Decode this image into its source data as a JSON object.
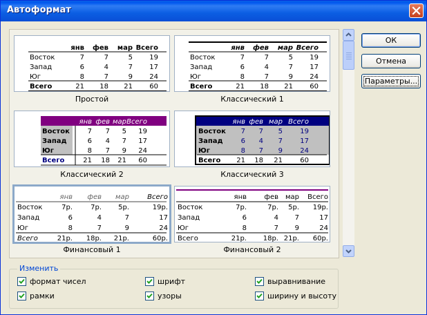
{
  "window": {
    "title": "Автоформат",
    "close_icon": "close-icon"
  },
  "buttons": {
    "ok": "ОК",
    "cancel": "Отмена",
    "params": "Параметры..."
  },
  "gallery": {
    "items": [
      {
        "name": "Простой",
        "header": [
          "",
          "янв",
          "фев",
          "мар",
          "Всего"
        ],
        "rows": [
          [
            "Восток",
            "7",
            "7",
            "5",
            "19"
          ],
          [
            "Запад",
            "6",
            "4",
            "7",
            "17"
          ],
          [
            "Юг",
            "8",
            "7",
            "9",
            "24"
          ]
        ],
        "total": [
          "Всего",
          "21",
          "18",
          "21",
          "60"
        ]
      },
      {
        "name": "Классический 1",
        "header": [
          "",
          "янв",
          "фев",
          "мар",
          "Всего"
        ],
        "rows": [
          [
            "Восток",
            "7",
            "7",
            "5",
            "19"
          ],
          [
            "Запад",
            "6",
            "4",
            "7",
            "17"
          ],
          [
            "Юг",
            "8",
            "7",
            "9",
            "24"
          ]
        ],
        "total": [
          "Всего",
          "21",
          "18",
          "21",
          "60"
        ]
      },
      {
        "name": "Классический 2",
        "header": [
          "",
          "янв",
          "фев",
          "мар",
          "Всего"
        ],
        "rows": [
          [
            "Восток",
            "7",
            "7",
            "5",
            "19"
          ],
          [
            "Запад",
            "6",
            "4",
            "7",
            "17"
          ],
          [
            "Юг",
            "8",
            "7",
            "9",
            "24"
          ]
        ],
        "total": [
          "Всего",
          "21",
          "18",
          "21",
          "60"
        ]
      },
      {
        "name": "Классический 3",
        "header": [
          "",
          "янв",
          "фев",
          "мар",
          "Всего"
        ],
        "rows": [
          [
            "Восток",
            "7",
            "7",
            "5",
            "19"
          ],
          [
            "Запад",
            "6",
            "4",
            "7",
            "17"
          ],
          [
            "Юг",
            "8",
            "7",
            "9",
            "24"
          ]
        ],
        "total": [
          "Всего",
          "21",
          "18",
          "21",
          "60"
        ]
      },
      {
        "name": "Финансовый 1",
        "header": [
          "",
          "янв",
          "фев",
          "мар",
          "Всего"
        ],
        "rows": [
          [
            "Восток",
            "7р.",
            "7р.",
            "5р.",
            "19р."
          ],
          [
            "Запад",
            "6",
            "4",
            "7",
            "17"
          ],
          [
            "Юг",
            "8",
            "7",
            "9",
            "24"
          ]
        ],
        "total": [
          "Всего",
          "21р.",
          "18р.",
          "21р.",
          "60р."
        ]
      },
      {
        "name": "Финансовый 2",
        "header": [
          "",
          "янв",
          "фев",
          "мар",
          "Всего"
        ],
        "rows": [
          [
            "Восток",
            "7р.",
            "7р.",
            "5р.",
            "19р."
          ],
          [
            "Запад",
            "6",
            "4",
            "7",
            "17"
          ],
          [
            "Юг",
            "8",
            "7",
            "9",
            "24"
          ]
        ],
        "total": [
          "Всего",
          "21р.",
          "18р.",
          "21р.",
          "60р."
        ]
      }
    ]
  },
  "modify_group": {
    "label": "Изменить",
    "options": [
      {
        "label": "формат чисел",
        "checked": true
      },
      {
        "label": "рамки",
        "checked": true
      },
      {
        "label": "шрифт",
        "checked": true
      },
      {
        "label": "узоры",
        "checked": true
      },
      {
        "label": "выравнивание",
        "checked": true
      },
      {
        "label": "ширину и высоту",
        "checked": true
      }
    ]
  },
  "colors": {
    "title_bar": "#0A5FE6",
    "classic2_header": "#800080",
    "classic3_header": "#000080",
    "classic3_body": "#C0C0C0",
    "fin2_rule": "#800080",
    "group_label": "#0046D5"
  }
}
